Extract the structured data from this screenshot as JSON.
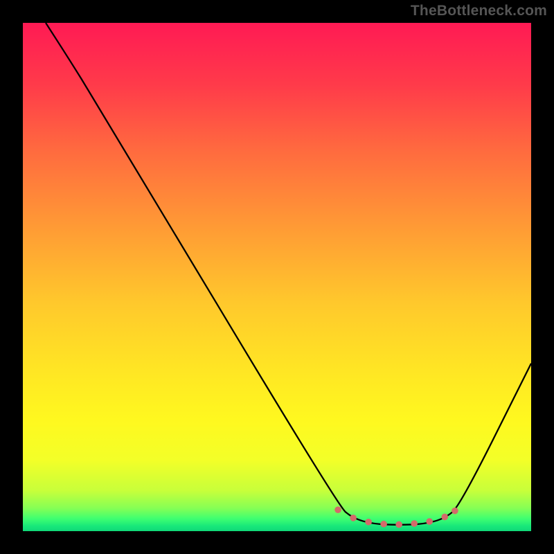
{
  "watermark": "TheBottleneck.com",
  "chart_data": {
    "type": "line",
    "title": "",
    "xlabel": "",
    "ylabel": "",
    "xlim": [
      0,
      100
    ],
    "ylim": [
      0,
      100
    ],
    "curve": {
      "name": "bottleneck-curve",
      "color": "#000000",
      "points": [
        {
          "x": 4.5,
          "y": 100
        },
        {
          "x": 9,
          "y": 93
        },
        {
          "x": 14,
          "y": 85
        },
        {
          "x": 62,
          "y": 5
        },
        {
          "x": 65,
          "y": 2.5
        },
        {
          "x": 69,
          "y": 1.4
        },
        {
          "x": 74,
          "y": 1.2
        },
        {
          "x": 79,
          "y": 1.4
        },
        {
          "x": 83,
          "y": 2.5
        },
        {
          "x": 86,
          "y": 5
        },
        {
          "x": 100,
          "y": 33
        }
      ]
    },
    "valley_markers": {
      "color": "#d36a6a",
      "points": [
        {
          "x": 62,
          "y": 4.2
        },
        {
          "x": 65,
          "y": 2.6
        },
        {
          "x": 68,
          "y": 1.8
        },
        {
          "x": 71,
          "y": 1.4
        },
        {
          "x": 74,
          "y": 1.3
        },
        {
          "x": 77,
          "y": 1.5
        },
        {
          "x": 80,
          "y": 1.9
        },
        {
          "x": 83,
          "y": 2.8
        },
        {
          "x": 85,
          "y": 4.0
        }
      ]
    },
    "gradient_stops": [
      {
        "offset": 0.0,
        "color": "#ff1a54"
      },
      {
        "offset": 0.12,
        "color": "#ff3a4a"
      },
      {
        "offset": 0.25,
        "color": "#ff6a3f"
      },
      {
        "offset": 0.4,
        "color": "#ff9a35"
      },
      {
        "offset": 0.55,
        "color": "#ffc82c"
      },
      {
        "offset": 0.68,
        "color": "#ffe524"
      },
      {
        "offset": 0.78,
        "color": "#fff81f"
      },
      {
        "offset": 0.86,
        "color": "#f3ff28"
      },
      {
        "offset": 0.92,
        "color": "#c8ff3a"
      },
      {
        "offset": 0.955,
        "color": "#85ff55"
      },
      {
        "offset": 0.975,
        "color": "#40ff70"
      },
      {
        "offset": 0.99,
        "color": "#18e87a"
      },
      {
        "offset": 1.0,
        "color": "#10d878"
      }
    ]
  }
}
